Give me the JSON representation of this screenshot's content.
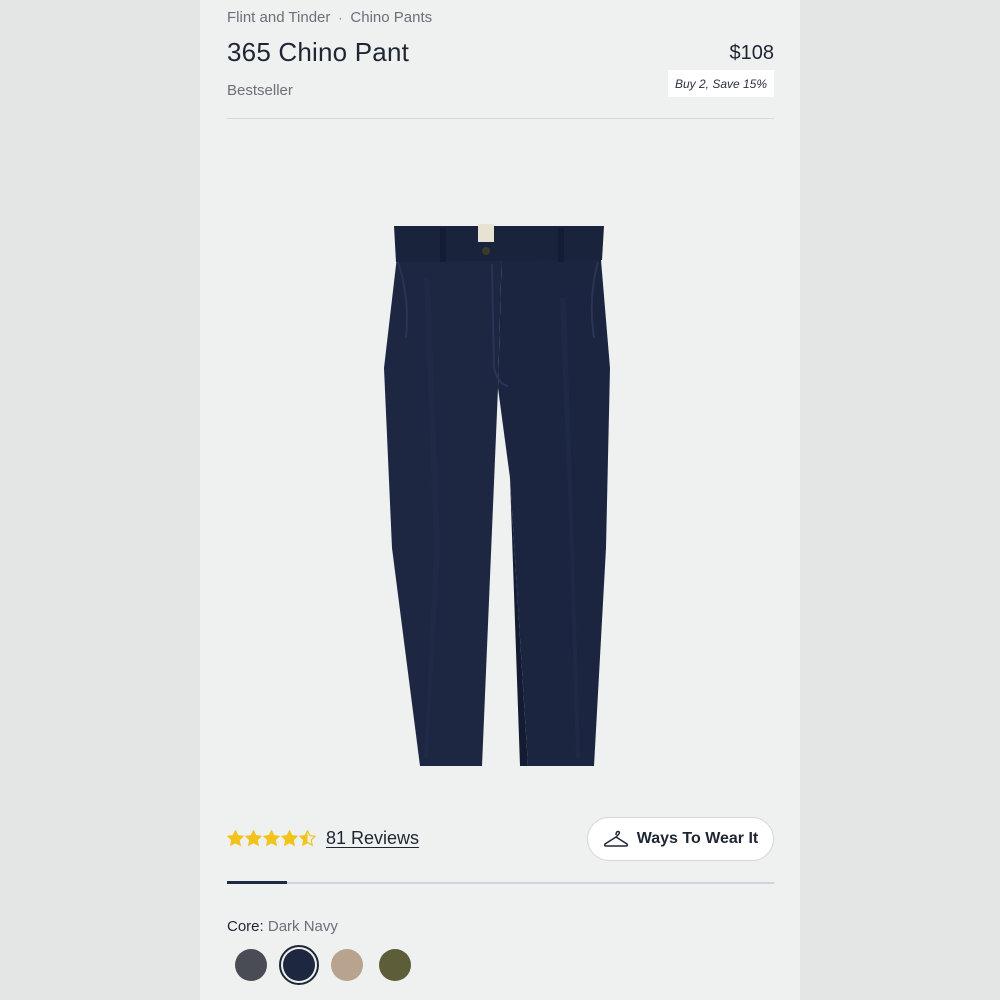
{
  "breadcrumb": {
    "brand": "Flint and Tinder",
    "separator": "·",
    "category": "Chino Pants"
  },
  "product": {
    "title": "365 Chino Pant",
    "price": "$108",
    "promo": "Buy 2, Save 15%",
    "badge": "Bestseller"
  },
  "rating": {
    "stars": 4.5,
    "reviews_label": "81 Reviews",
    "star_color": "#f2c31a"
  },
  "ways_to_wear": {
    "icon": "hanger-icon",
    "label": "Ways To Wear It"
  },
  "image_gallery": {
    "progress": 0.11,
    "progress_color": "#1e2a44"
  },
  "color_selector": {
    "group_label": "Core:",
    "selected_name": "Dark Navy",
    "swatches": [
      {
        "color": "#4a4c55",
        "selected": false
      },
      {
        "color": "#1e2740",
        "selected": true
      },
      {
        "color": "#b8a48e",
        "selected": false
      },
      {
        "color": "#5e5d3a",
        "selected": false
      }
    ]
  }
}
